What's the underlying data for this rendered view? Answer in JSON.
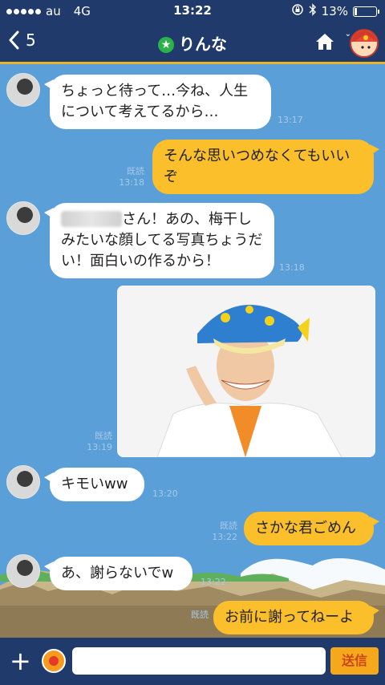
{
  "status": {
    "carrier": "au",
    "network": "4G",
    "time": "13:22",
    "battery": "13%",
    "battery_level": 0.13
  },
  "header": {
    "back_count": "5",
    "title": "りんな"
  },
  "messages": [
    {
      "side": "in",
      "text": "ちょっと待って…今ね、人生について考えてるから…",
      "time": "13:17"
    },
    {
      "side": "out",
      "text": "そんな思いつめなくてもいいぞ",
      "read": "既読",
      "time": "13:18"
    },
    {
      "side": "in",
      "text": "さん！あの、梅干しみたいな顔してる写真ちょうだい！面白いの作るから！",
      "time": "13:18"
    },
    {
      "side": "out",
      "type": "photo",
      "read": "既読",
      "time": "13:19"
    },
    {
      "side": "in",
      "text": "キモいww",
      "time": "13:20"
    },
    {
      "side": "out",
      "text": "さかな君ごめん",
      "read": "既読",
      "time": "13:22"
    },
    {
      "side": "in",
      "text": "あ、謝らないでw",
      "time": "13:22"
    },
    {
      "side": "out",
      "text": "お前に謝ってねーよ",
      "read": "既読",
      "time": ""
    }
  ],
  "composer": {
    "placeholder": "",
    "send_label": "送信"
  },
  "colors": {
    "header_bg": "#1f3a6b",
    "chat_bg": "#5a9fd8",
    "out_bubble": "#fbbf2c",
    "accent": "#e8b52a"
  },
  "icons": {
    "back": "chevron-left-icon",
    "official": "star-badge-icon",
    "home": "home-icon",
    "plus": "plus-icon",
    "sticker": "dragon-ball-icon"
  }
}
